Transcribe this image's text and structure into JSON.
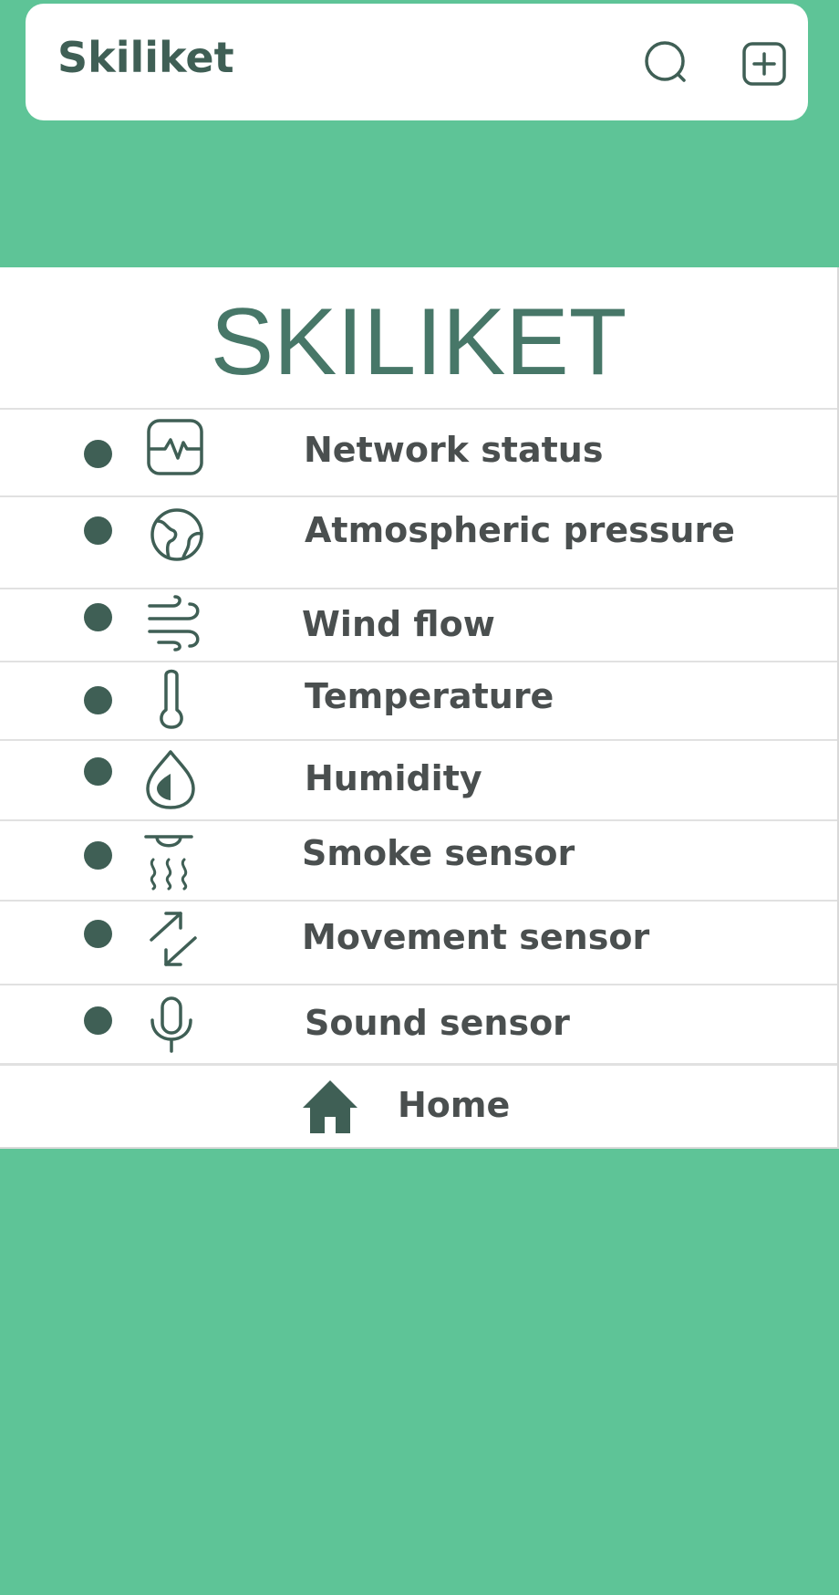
{
  "header": {
    "title": "Skiliket",
    "search_icon": "search-icon",
    "add_icon": "add-square-icon"
  },
  "main": {
    "title": "SKILIKET",
    "sensors": [
      {
        "label": "Network status",
        "icon": "activity-icon"
      },
      {
        "label": "Atmospheric pressure",
        "icon": "globe-icon"
      },
      {
        "label": "Wind flow",
        "icon": "wind-icon"
      },
      {
        "label": "Temperature",
        "icon": "thermometer-icon"
      },
      {
        "label": "Humidity",
        "icon": "drop-icon"
      },
      {
        "label": "Smoke sensor",
        "icon": "smoke-detector-icon"
      },
      {
        "label": "Movement sensor",
        "icon": "arrows-icon"
      },
      {
        "label": "Sound sensor",
        "icon": "microphone-icon"
      }
    ],
    "home": {
      "label": "Home",
      "icon": "home-icon"
    }
  },
  "colors": {
    "background": "#5ec497",
    "accent_dark": "#3f5f55",
    "title_green": "#477768",
    "text": "#4a4f4f"
  }
}
